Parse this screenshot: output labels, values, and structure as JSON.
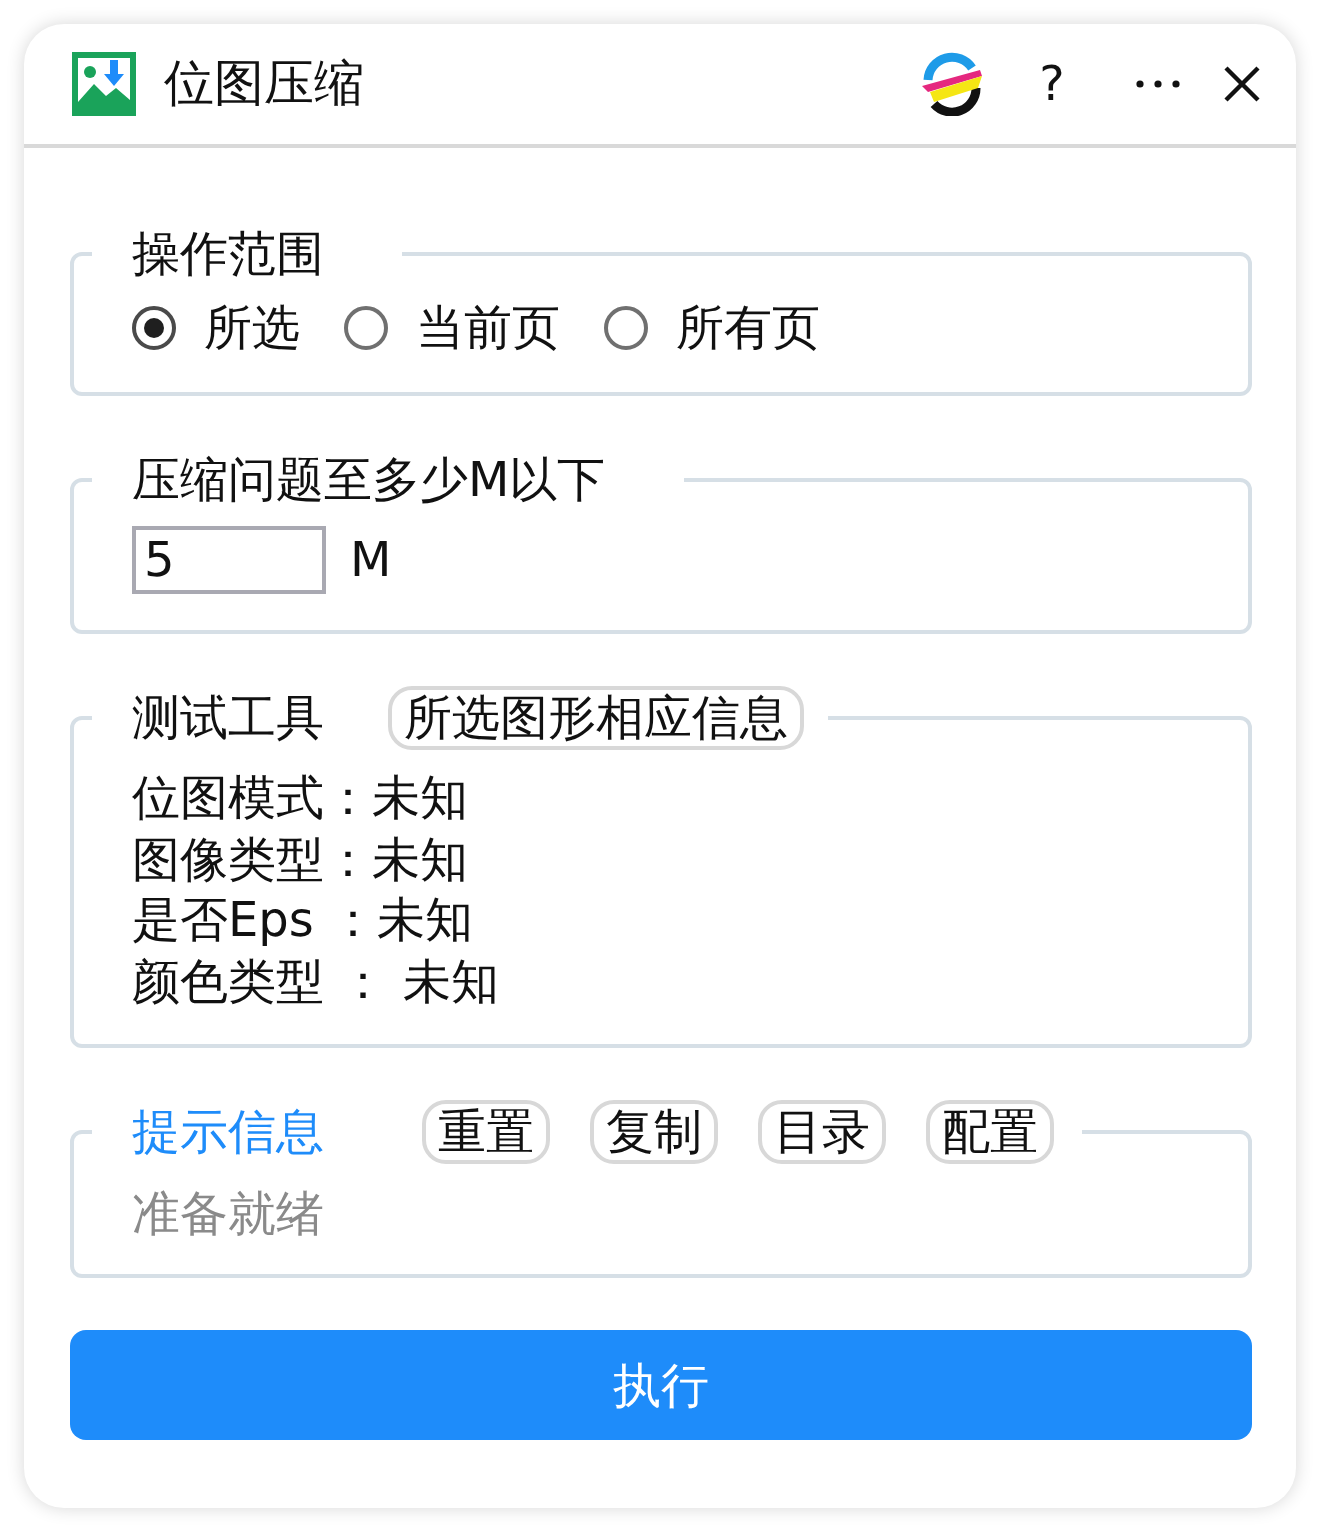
{
  "title_bar": {
    "title": "位图压缩",
    "actions": [
      {
        "kind": "logo"
      },
      {
        "kind": "help",
        "label": "?"
      },
      {
        "kind": "more"
      },
      {
        "kind": "close"
      }
    ]
  },
  "sections": [
    {
      "kind": "radio",
      "title": "操作范围",
      "options": [
        {
          "label": "所选",
          "selected": true
        },
        {
          "label": "当前页",
          "selected": false
        },
        {
          "label": "所有页",
          "selected": false
        }
      ]
    },
    {
      "kind": "number",
      "title": "压缩问题至多少M以下",
      "value": "5",
      "unit": "M"
    },
    {
      "kind": "info",
      "title": "测试工具",
      "buttons": [
        "所选图形相应信息"
      ],
      "lines": [
        "位图模式：未知",
        "图像类型：未知",
        "是否Eps ：未知",
        "颜色类型 ： 未知"
      ]
    },
    {
      "kind": "log",
      "title": "提示信息",
      "buttons": [
        "重置",
        "复制",
        "目录",
        "配置"
      ],
      "status": "准备就绪"
    }
  ],
  "run_button": {
    "label": "执行"
  }
}
